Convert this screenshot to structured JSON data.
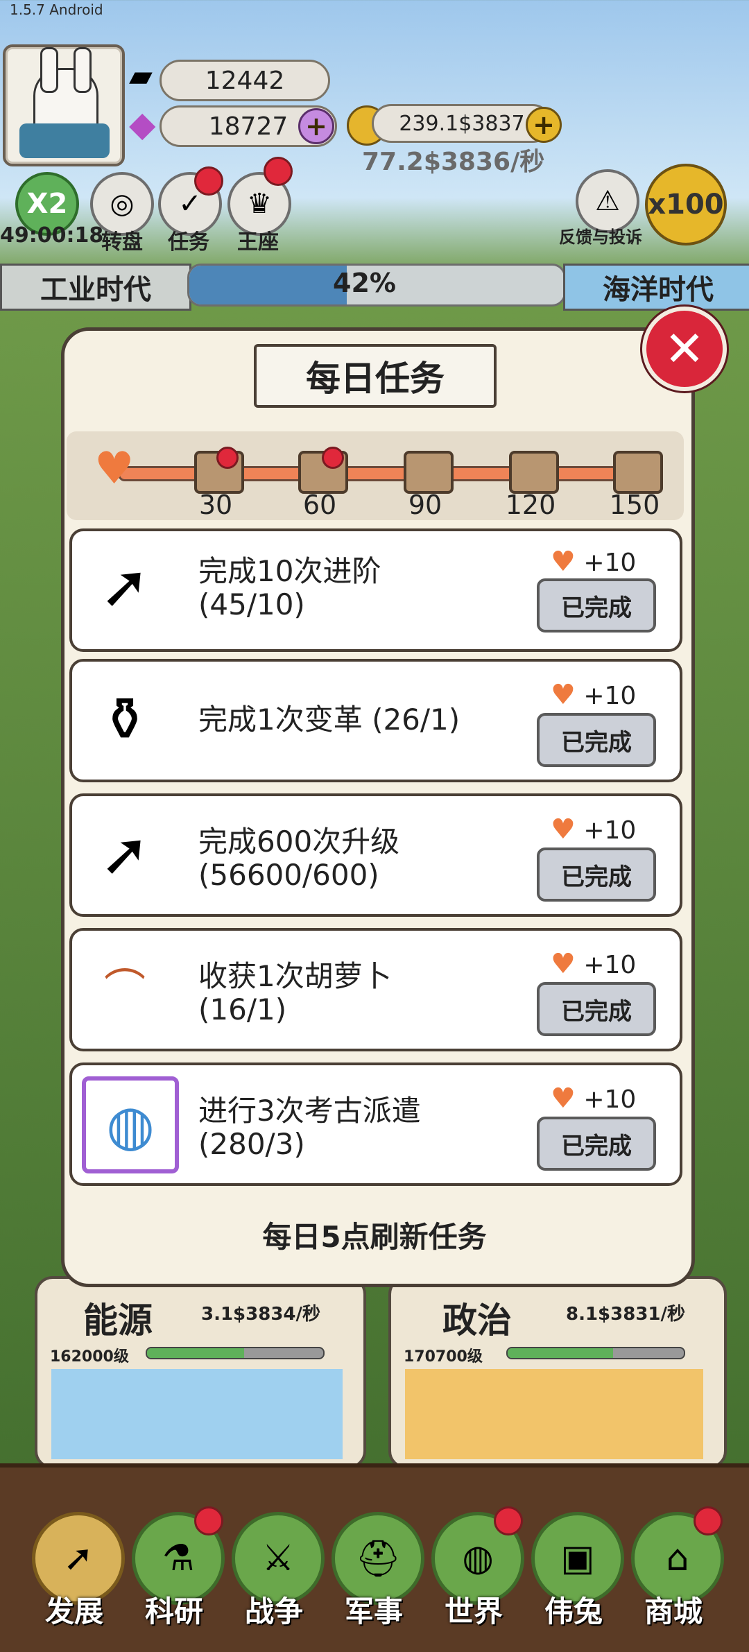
{
  "version": "1.5.7 Android",
  "hud": {
    "silver_value": "12442",
    "gem_value": "18727",
    "coin_value": "239.1$3837",
    "rate_text": "77.2$3836/秒",
    "boost_label": "X2",
    "timer_text": "49:00:18",
    "wheel_label": "转盘",
    "tasks_label": "任务",
    "throne_label": "王座",
    "feedback_label": "反馈与投诉",
    "multiplier": "x100"
  },
  "era": {
    "current": "工业时代",
    "next": "海洋时代",
    "progress_text": "42%",
    "progress": 0.42
  },
  "modal": {
    "title": "每日任务",
    "milestones": [
      "30",
      "60",
      "90",
      "120",
      "150"
    ],
    "tasks": [
      {
        "icon": "arrow-up-icon",
        "line1": "完成10次进阶",
        "line2": "(45/10)",
        "reward": "+10",
        "status": "已完成"
      },
      {
        "icon": "potion-icon",
        "line1": "完成1次变革 (26/1)",
        "line2": "",
        "reward": "+10",
        "status": "已完成"
      },
      {
        "icon": "arrow-up-icon",
        "line1": "完成600次升级",
        "line2": "(56600/600)",
        "reward": "+10",
        "status": "已完成"
      },
      {
        "icon": "carrot-icon",
        "line1": "收获1次胡萝卜",
        "line2": "(16/1)",
        "reward": "+10",
        "status": "已完成"
      },
      {
        "icon": "globe-icon",
        "line1": "进行3次考古派遣",
        "line2": "(280/3)",
        "reward": "+10",
        "status": "已完成"
      }
    ],
    "footer": "每日5点刷新任务"
  },
  "cards": [
    {
      "name": "能源",
      "rate": "3.1$3834/秒",
      "level": "162000级",
      "progress": 0.55
    },
    {
      "name": "政治",
      "rate": "8.1$3831/秒",
      "level": "170700级",
      "progress": 0.6
    }
  ],
  "nav": [
    "发展",
    "科研",
    "战争",
    "军事",
    "世界",
    "伟兔",
    "商城"
  ],
  "colors": {
    "accent_red": "#e0283b",
    "heart": "#ef7a3e",
    "panel": "#f6f1e3"
  }
}
